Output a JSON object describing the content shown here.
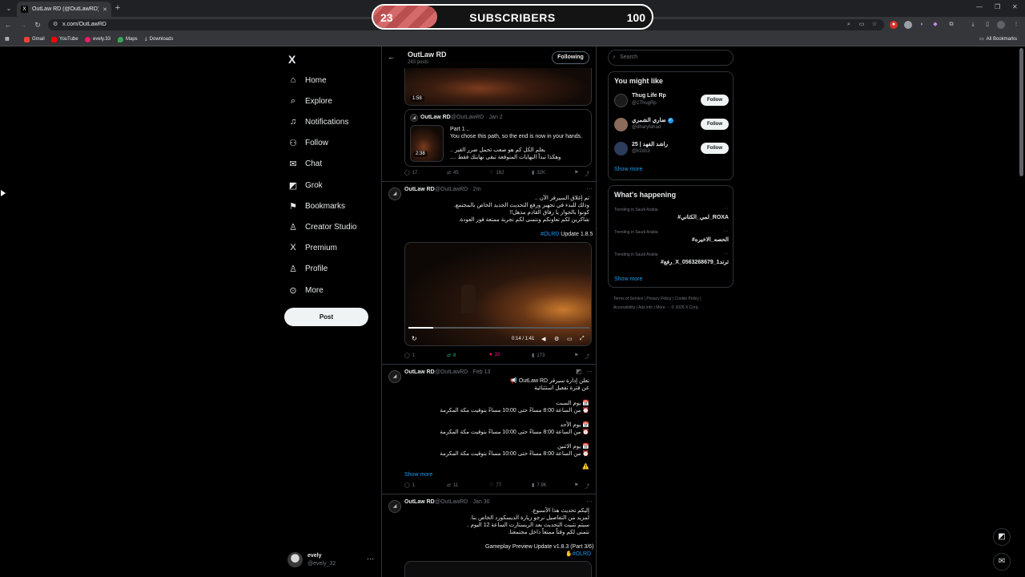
{
  "browser": {
    "tab_title": "OutLaw RD (@OutLawRD) / X",
    "url": "x.com/OutLawRD",
    "bookmarks": [
      "Gmail",
      "YouTube",
      "evely.33",
      "Maps",
      "Downloads"
    ],
    "all_bookmarks": "All Bookmarks"
  },
  "overlay": {
    "current": "23",
    "label": "SUBSCRIBERS",
    "goal": "100",
    "progress_fraction": 0.23
  },
  "nav": {
    "logo": "X",
    "items": [
      {
        "label": "Home",
        "icon": "home-icon"
      },
      {
        "label": "Explore",
        "icon": "search-icon"
      },
      {
        "label": "Notifications",
        "icon": "bell-icon"
      },
      {
        "label": "Follow",
        "icon": "person-add-icon"
      },
      {
        "label": "Chat",
        "icon": "mail-icon"
      },
      {
        "label": "Grok",
        "icon": "grok-icon"
      },
      {
        "label": "Bookmarks",
        "icon": "bookmark-icon"
      },
      {
        "label": "Creator Studio",
        "icon": "creator-icon"
      },
      {
        "label": "Premium",
        "icon": "x-icon"
      },
      {
        "label": "Profile",
        "icon": "person-icon"
      },
      {
        "label": "More",
        "icon": "more-circle-icon"
      }
    ],
    "post_label": "Post"
  },
  "account": {
    "name": "evely",
    "handle": "@evely_32"
  },
  "profile_header": {
    "name": "OutLaw RD",
    "posts": "243 posts",
    "following_label": "Following"
  },
  "posts": [
    {
      "video_duration": "1:58",
      "quote": {
        "name": "OutLaw RD",
        "handle": "@OutLawRD · Jan 2",
        "duration": "2:38",
        "lines": [
          "Part 1 ..",
          "You chose this path, so the end is now in your hands.",
          "يعلم الكل كم هو صعب تحمل ضرر الغير ..",
          "وهكذا تبدأ النهايات المتوقعة تبقى نهايتك فقط ...."
        ]
      },
      "stats": {
        "replies": "17",
        "reposts": "45",
        "likes": "162",
        "views": "32K"
      }
    },
    {
      "name": "OutLaw RD",
      "handle": "@OutLawRD · 2m",
      "lines": [
        "تم إغلاق السيرفر الآن ..",
        "وذلك للبدء في تجهيز ورفع التحديث الجديد الخاص بالمجتمع.",
        "كونوا بالجوار يا رفاق القادم مذهل!!",
        "شاكرين لكم تعاونكم ونتمنى لكم تجربة ممتعة فور العودة."
      ],
      "hashtag": "#OLRD",
      "update": "Update 1.8.5",
      "video_time": "0:14 / 1:41",
      "stats": {
        "replies": "1",
        "reposts": "8",
        "likes": "33",
        "views": "173"
      }
    },
    {
      "name": "OutLaw RD",
      "handle": "@OutLawRD · Feb 13",
      "lines": [
        "تعلن إدارة سيرفر OutLaw RD 📢",
        "عن فترة تفعيل استثنائية",
        "📅 يوم السبت",
        "⏰ من الساعة 8:00 مساءً حتى 10:00 مساءً بتوقيت مكة المكرمة",
        "📅 يوم الأحد",
        "⏰ من الساعة 8:00 مساءً حتى 10:00 مساءً بتوقيت مكة المكرمة",
        "📅 يوم الاثنين",
        "⏰ من الساعة 8:00 مساءً حتى 10:00 مساءً بتوقيت مكة المكرمة",
        "⚠️"
      ],
      "show_more": "Show more",
      "stats": {
        "replies": "1",
        "reposts": "11",
        "likes": "77",
        "views": "7.9K"
      }
    },
    {
      "name": "OutLaw RD",
      "handle": "@OutLawRD · Jan 30",
      "lines": [
        "إليكم تحديث هذا الأسبوع.",
        "لمزيد من التفاصيل نرجو زيارة الديسكورد الخاص بنا.",
        "سيتم تثبيت التحديث بعد الريستارت الساعة 12 اليوم .",
        "نتمنى لكم وقتاً ممتعاً داخل مجتمعنا."
      ],
      "footer_text": "Gameplay Preview Update v1.8.3 (Part 3/6)",
      "hashtag": "#OLRD"
    }
  ],
  "right": {
    "search_placeholder": "Search",
    "you_might_like": "You might like",
    "suggestions": [
      {
        "name": "Thug Life Rp",
        "handle": "@1ThugRp",
        "follow": "Follow"
      },
      {
        "name": "ضاري الشمري",
        "handle": "@dharyfahad",
        "follow": "Follow"
      },
      {
        "name": "25 | راشد الفهد",
        "handle": "@lr2d13",
        "follow": "Follow"
      }
    ],
    "show_more": "Show more",
    "whats_happening": "What's happening",
    "trends": [
      {
        "context": "Trending in Saudi Arabia",
        "tag": "#لمي_الكتاني_ROXA"
      },
      {
        "context": "Trending in Saudi Arabia",
        "tag": "#الحصه_الاخيره"
      },
      {
        "context": "Trending in Saudi Arabia",
        "tag": "#رفع_X_ترند1_0563268679"
      }
    ],
    "footer_line1": [
      "Terms of Service",
      "Privacy Policy",
      "Cookie Policy"
    ],
    "footer_line2": [
      "Accessibility",
      "Ads info",
      "More ···",
      "© 2026 X Corp."
    ]
  }
}
